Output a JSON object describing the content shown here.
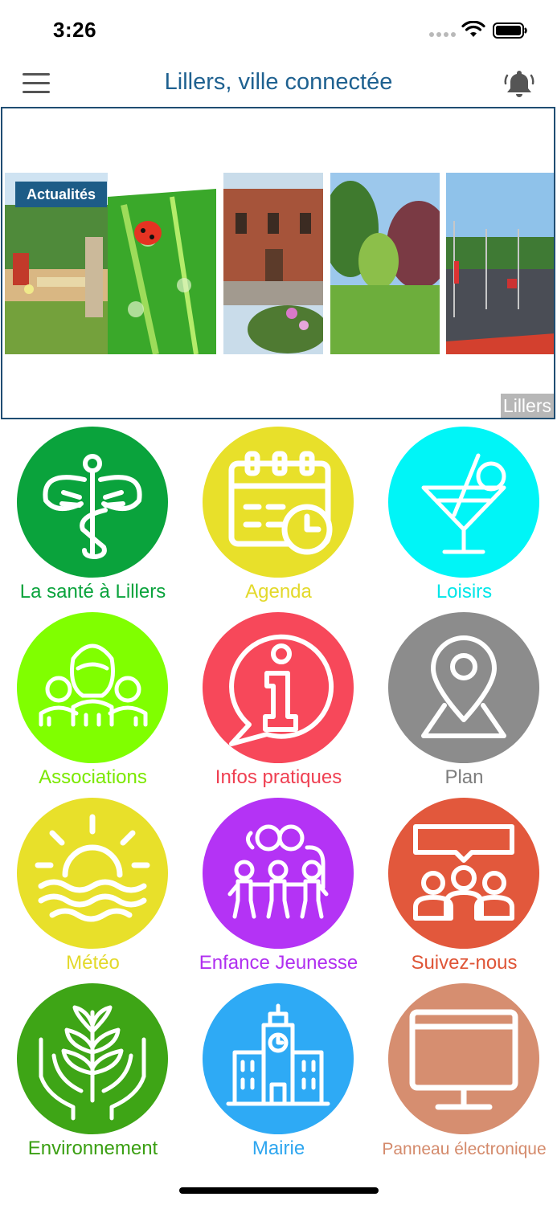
{
  "status": {
    "time": "3:26"
  },
  "header": {
    "title": "Lillers, ville connectée"
  },
  "banner": {
    "category": "Actualités",
    "location": "Lillers"
  },
  "tiles": [
    {
      "label": "La santé à Lillers",
      "color": "#0aa33c",
      "text_color": "#0aa33c",
      "icon": "caduceus-icon"
    },
    {
      "label": "Agenda",
      "color": "#e8e02a",
      "text_color": "#e3d92a",
      "icon": "calendar-clock-icon"
    },
    {
      "label": "Loisirs",
      "color": "#00f5f7",
      "text_color": "#00e6e8",
      "icon": "cocktail-icon"
    },
    {
      "label": "Associations",
      "color": "#80ff00",
      "text_color": "#7be800",
      "icon": "people-group-icon"
    },
    {
      "label": "Infos pratiques",
      "color": "#f7485a",
      "text_color": "#ef3f51",
      "icon": "info-bubble-icon"
    },
    {
      "label": "Plan",
      "color": "#8c8c8c",
      "text_color": "#7d7d7d",
      "icon": "map-pin-icon"
    },
    {
      "label": "Météo",
      "color": "#e8e02a",
      "text_color": "#e3d92a",
      "icon": "sun-sea-icon"
    },
    {
      "label": "Enfance Jeunesse",
      "color": "#b433f5",
      "text_color": "#b02ff0",
      "icon": "family-icon"
    },
    {
      "label": "Suivez-nous",
      "color": "#e2583c",
      "text_color": "#df5537",
      "icon": "community-chat-icon"
    },
    {
      "label": "Environnement",
      "color": "#3ea516",
      "text_color": "#3a9f12",
      "icon": "plant-hands-icon"
    },
    {
      "label": "Mairie",
      "color": "#2eaaf5",
      "text_color": "#2ea6ef",
      "icon": "town-hall-icon"
    },
    {
      "label": "Panneau électronique",
      "color": "#d68e70",
      "text_color": "#d48a6b",
      "icon": "monitor-icon"
    }
  ]
}
